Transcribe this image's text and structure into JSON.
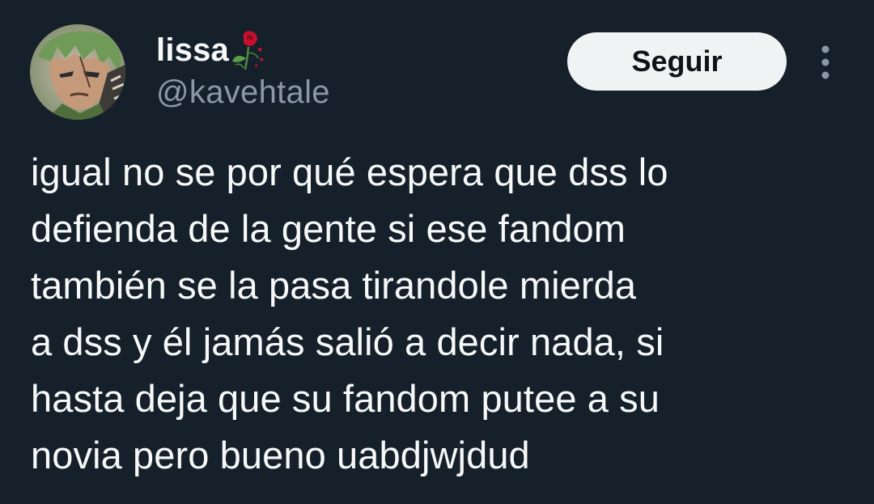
{
  "author": {
    "display_name": "lissa",
    "display_name_emoji": "rose-icon",
    "handle": "@kavehtale",
    "avatar": "avatar-anime-character"
  },
  "actions": {
    "follow_label": "Seguir",
    "more_icon": "more-vertical-icon"
  },
  "tweet": {
    "lines": [
      "igual no se por qué espera que dss lo",
      "defienda de la gente si ese fandom",
      "también se la pasa tirandole mierda",
      "a dss y él jamás salió a decir nada, si",
      "hasta deja que su fandom putee a su",
      "novia pero bueno uabdjwjdud"
    ]
  },
  "colors": {
    "background": "#15202b",
    "text_primary": "#f7f9f9",
    "text_secondary": "#8b98a5",
    "button_bg": "#eff3f4",
    "button_text": "#0f1419"
  }
}
